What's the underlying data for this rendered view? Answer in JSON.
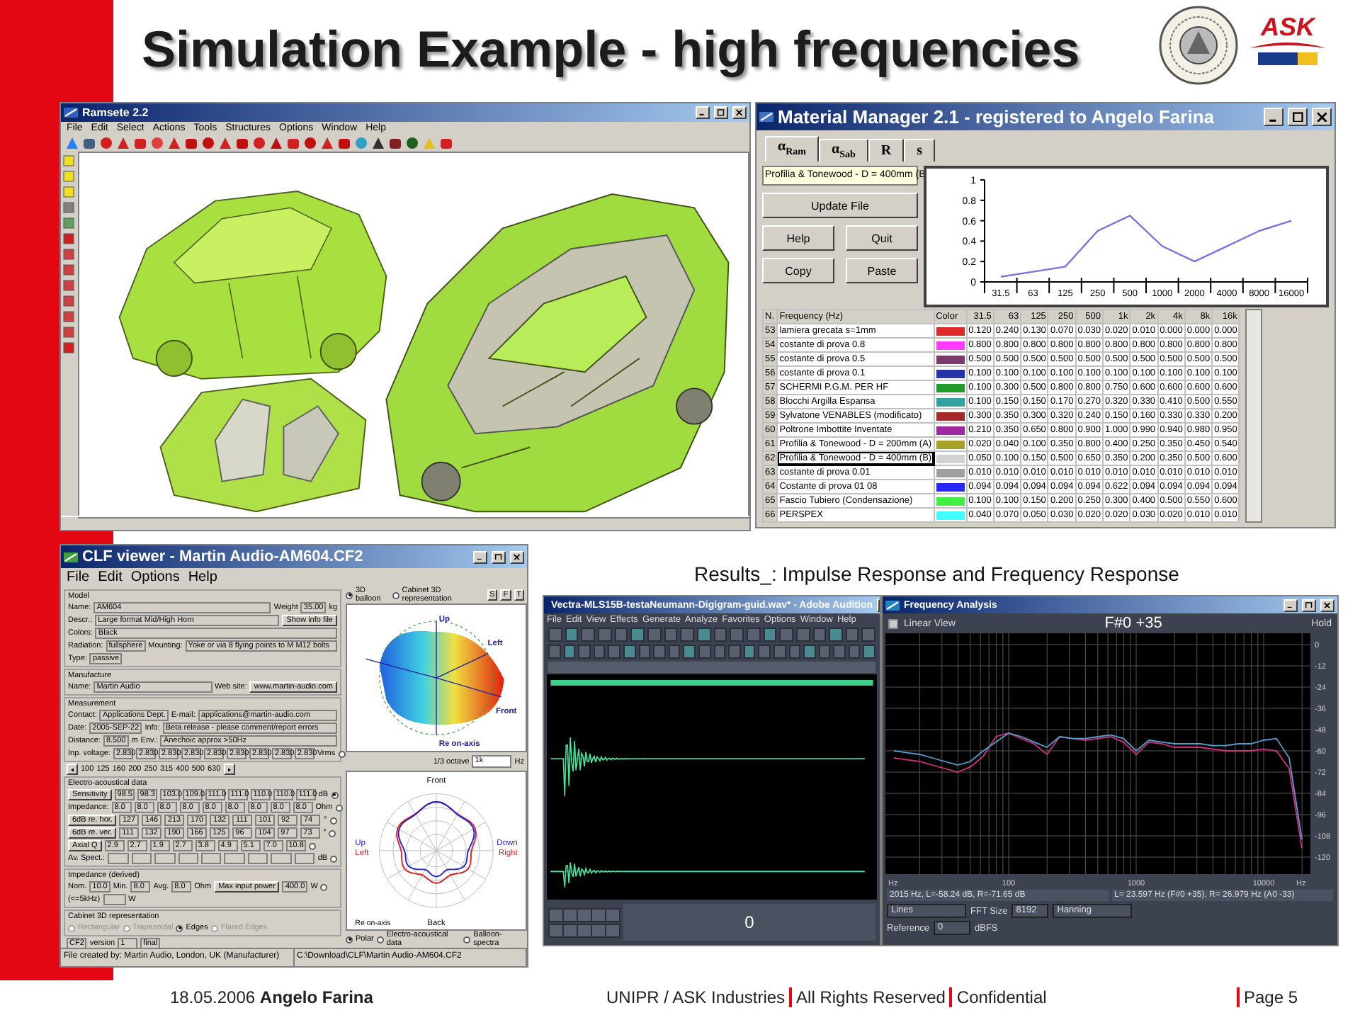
{
  "slide": {
    "title": "Simulation Example - high frequencies",
    "logo_text": "ASK",
    "results_caption": "Results_: Impulse Response and Frequency Response"
  },
  "ramsete": {
    "title": "Ramsete 2.2",
    "menu": [
      "File",
      "Edit",
      "Select",
      "Actions",
      "Tools",
      "Structures",
      "Options",
      "Window",
      "Help"
    ]
  },
  "material_manager": {
    "title": "Material Manager 2.1 - registered to Angelo Farina",
    "tabs": [
      {
        "label": "α$_{Ram}$",
        "selected": true
      },
      {
        "label": "α$_{Sab}$",
        "selected": false
      },
      {
        "label": "R",
        "selected": false
      },
      {
        "label": "s",
        "selected": false
      }
    ],
    "material_field": "Profilia & Tonewood - D = 400mm (B",
    "buttons": [
      "Update File",
      "Help",
      "Quit",
      "Copy",
      "Paste"
    ],
    "chart_data": {
      "type": "line",
      "categories": [
        "31.5",
        "63",
        "125",
        "250",
        "500",
        "1000",
        "2000",
        "4000",
        "8000",
        "16000"
      ],
      "ylim": [
        0,
        1
      ],
      "yticks": [
        0,
        0.2,
        0.4,
        0.6,
        0.8,
        1
      ],
      "series": [
        {
          "color": "#7b72e6",
          "values": [
            0.05,
            0.1,
            0.15,
            0.5,
            0.65,
            0.35,
            0.2,
            0.35,
            0.5,
            0.6
          ]
        }
      ]
    },
    "table": {
      "columns": [
        "N.",
        "Frequency (Hz)",
        "Color",
        "31.5",
        "63",
        "125",
        "250",
        "500",
        "1k",
        "2k",
        "4k",
        "8k",
        "16k"
      ],
      "rows": [
        {
          "n": "53",
          "name": "lamiera grecata s=1mm",
          "color": "#e02828",
          "selected": false,
          "values": [
            "0.120",
            "0.240",
            "0.130",
            "0.070",
            "0.030",
            "0.020",
            "0.010",
            "0.000",
            "0.000",
            "0.000"
          ]
        },
        {
          "n": "54",
          "name": "costante di prova 0.8",
          "color": "#ff3cff",
          "selected": false,
          "values": [
            "0.800",
            "0.800",
            "0.800",
            "0.800",
            "0.800",
            "0.800",
            "0.800",
            "0.800",
            "0.800",
            "0.800"
          ]
        },
        {
          "n": "55",
          "name": "costante di prova 0.5",
          "color": "#7a3a6a",
          "selected": false,
          "values": [
            "0.500",
            "0.500",
            "0.500",
            "0.500",
            "0.500",
            "0.500",
            "0.500",
            "0.500",
            "0.500",
            "0.500"
          ]
        },
        {
          "n": "56",
          "name": "costante di prova 0.1",
          "color": "#2832a8",
          "selected": false,
          "values": [
            "0.100",
            "0.100",
            "0.100",
            "0.100",
            "0.100",
            "0.100",
            "0.100",
            "0.100",
            "0.100",
            "0.100"
          ]
        },
        {
          "n": "57",
          "name": "SCHERMI P.G.M. PER HF",
          "color": "#209a28",
          "selected": false,
          "values": [
            "0.100",
            "0.300",
            "0.500",
            "0.800",
            "0.800",
            "0.750",
            "0.600",
            "0.600",
            "0.600",
            "0.600"
          ]
        },
        {
          "n": "58",
          "name": "Blocchi Argilla Espansa",
          "color": "#30a0a0",
          "selected": false,
          "values": [
            "0.100",
            "0.150",
            "0.150",
            "0.170",
            "0.270",
            "0.320",
            "0.330",
            "0.410",
            "0.500",
            "0.550"
          ]
        },
        {
          "n": "59",
          "name": "Sylvatone VENABLES (modificato)",
          "color": "#a82828",
          "selected": false,
          "values": [
            "0.300",
            "0.350",
            "0.300",
            "0.320",
            "0.240",
            "0.150",
            "0.160",
            "0.330",
            "0.330",
            "0.200"
          ]
        },
        {
          "n": "60",
          "name": "Poltrone Imbottite Inventate",
          "color": "#a028a0",
          "selected": false,
          "values": [
            "0.210",
            "0.350",
            "0.650",
            "0.800",
            "0.900",
            "1.000",
            "0.990",
            "0.940",
            "0.980",
            "0.950"
          ]
        },
        {
          "n": "61",
          "name": "Profilia & Tonewood - D = 200mm (A)",
          "color": "#a8a028",
          "selected": false,
          "values": [
            "0.020",
            "0.040",
            "0.100",
            "0.350",
            "0.800",
            "0.400",
            "0.250",
            "0.350",
            "0.450",
            "0.540"
          ]
        },
        {
          "n": "62",
          "name": "Profilia & Tonewood - D = 400mm (B)",
          "color": "#d2d2d2",
          "selected": true,
          "values": [
            "0.050",
            "0.100",
            "0.150",
            "0.500",
            "0.650",
            "0.350",
            "0.200",
            "0.350",
            "0.500",
            "0.600"
          ]
        },
        {
          "n": "63",
          "name": "costante di prova 0.01",
          "color": "#a0a0a0",
          "selected": false,
          "values": [
            "0.010",
            "0.010",
            "0.010",
            "0.010",
            "0.010",
            "0.010",
            "0.010",
            "0.010",
            "0.010",
            "0.010"
          ]
        },
        {
          "n": "64",
          "name": "Costante di prova 01 08",
          "color": "#2828ff",
          "selected": false,
          "values": [
            "0.094",
            "0.094",
            "0.094",
            "0.094",
            "0.094",
            "0.622",
            "0.094",
            "0.094",
            "0.094",
            "0.094"
          ]
        },
        {
          "n": "65",
          "name": "Fascio Tubiero (Condensazione)",
          "color": "#40f040",
          "selected": false,
          "values": [
            "0.100",
            "0.100",
            "0.150",
            "0.200",
            "0.250",
            "0.300",
            "0.400",
            "0.500",
            "0.550",
            "0.600"
          ]
        },
        {
          "n": "66",
          "name": "PERSPEX",
          "color": "#40ffff",
          "selected": false,
          "values": [
            "0.040",
            "0.070",
            "0.050",
            "0.030",
            "0.020",
            "0.020",
            "0.030",
            "0.020",
            "0.010",
            "0.010"
          ]
        }
      ]
    }
  },
  "clf_viewer": {
    "title": "CLF viewer - Martin Audio-AM604.CF2",
    "menu": [
      "File",
      "Edit",
      "Options",
      "Help"
    ],
    "groups": [
      {
        "title": "Model",
        "rows": [
          [
            {
              "kind": "label",
              "text": "Name:"
            },
            {
              "kind": "field",
              "text": "AM604"
            },
            {
              "kind": "label",
              "text": "Weight"
            },
            {
              "kind": "cell",
              "text": "35.00"
            },
            {
              "kind": "label",
              "text": "kg"
            }
          ],
          [
            {
              "kind": "label",
              "text": "Descr.:"
            },
            {
              "kind": "field",
              "text": "Large format Mid/High Horn"
            },
            {
              "kind": "button",
              "text": "Show info file"
            }
          ],
          [
            {
              "kind": "label",
              "text": "Colors:"
            },
            {
              "kind": "field",
              "text": "Black"
            }
          ],
          [
            {
              "kind": "label",
              "text": "Radiation:"
            },
            {
              "kind": "cell",
              "text": "fullsphere"
            },
            {
              "kind": "label",
              "text": "Mounting:"
            },
            {
              "kind": "field",
              "text": "Yoke or via 8 flying points to M M12 bolts"
            }
          ],
          [
            {
              "kind": "label",
              "text": "Type:"
            },
            {
              "kind": "cell",
              "text": "passive"
            }
          ]
        ]
      },
      {
        "title": "Manufacture",
        "rows": [
          [
            {
              "kind": "label",
              "text": "Name:"
            },
            {
              "kind": "field",
              "text": "Martin Audio"
            },
            {
              "kind": "label",
              "text": "Web site:"
            },
            {
              "kind": "button",
              "text": "www.martin-audio.com"
            }
          ]
        ]
      },
      {
        "title": "Measurement",
        "fields": [
          {
            "label": "Contact:",
            "value": "Applications Dept.",
            "label_2": "E-mail:",
            "value_2": "applications@martin-audio.com"
          },
          {
            "label": "Date:",
            "value": "2005-SEP-22",
            "label_2": "Info:",
            "value_2": "Beta release - please comment/report errors"
          },
          {
            "label": "Distance:",
            "value": "8.500",
            "unit": "m",
            "label_2": "Env.:",
            "value_2": "Anechoic approx >50Hz"
          }
        ],
        "voltage": {
          "label": "Inp. voltage:",
          "values": [
            "2.830",
            "2.830",
            "2.830",
            "2.830",
            "2.830",
            "2.830",
            "2.830",
            "2.830",
            "2.830"
          ],
          "unit": "Vrms",
          "selected": false
        }
      },
      {
        "rows": [
          [
            {
              "kind": "arrow_left"
            },
            {
              "kind": "label",
              "text": "100"
            },
            {
              "kind": "label",
              "text": "125"
            },
            {
              "kind": "label",
              "text": "160"
            },
            {
              "kind": "label",
              "text": "200"
            },
            {
              "kind": "label",
              "text": "250"
            },
            {
              "kind": "label",
              "text": "315"
            },
            {
              "kind": "label",
              "text": "400"
            },
            {
              "kind": "label",
              "text": "500"
            },
            {
              "kind": "label",
              "text": "630"
            },
            {
              "kind": "arrow_right"
            }
          ]
        ]
      },
      {
        "title": "Electro-acoustical data",
        "rows": [
          [
            {
              "kind": "button",
              "text": "Sensitivity"
            },
            {
              "kind": "cell",
              "text": "98.5"
            },
            {
              "kind": "cell",
              "text": "98.3"
            },
            {
              "kind": "cell",
              "text": "103.0"
            },
            {
              "kind": "cell",
              "text": "109.0"
            },
            {
              "kind": "cell",
              "text": "111.0"
            },
            {
              "kind": "cell",
              "text": "111.0"
            },
            {
              "kind": "cell",
              "text": "110.0"
            },
            {
              "kind": "cell",
              "text": "110.0"
            },
            {
              "kind": "cell",
              "text": "111.0"
            },
            {
              "kind": "label",
              "text": "dB"
            },
            {
              "kind": "radio",
              "selected": true
            }
          ],
          [
            {
              "kind": "label",
              "text": "Impedance:"
            },
            {
              "kind": "cell",
              "text": "8.0"
            },
            {
              "kind": "cell",
              "text": "8.0"
            },
            {
              "kind": "cell",
              "text": "8.0"
            },
            {
              "kind": "cell",
              "text": "8.0"
            },
            {
              "kind": "cell",
              "text": "8.0"
            },
            {
              "kind": "cell",
              "text": "8.0"
            },
            {
              "kind": "cell",
              "text": "8.0"
            },
            {
              "kind": "cell",
              "text": "8.0"
            },
            {
              "kind": "cell",
              "text": "8.0"
            },
            {
              "kind": "label",
              "text": "Ohm"
            },
            {
              "kind": "radio",
              "selected": false
            }
          ],
          [
            {
              "kind": "button",
              "text": "6dB re. hor."
            },
            {
              "kind": "cell",
              "text": "127"
            },
            {
              "kind": "cell",
              "text": "146"
            },
            {
              "kind": "cell",
              "text": "213"
            },
            {
              "kind": "cell",
              "text": "170"
            },
            {
              "kind": "cell",
              "text": "132"
            },
            {
              "kind": "cell",
              "text": "111"
            },
            {
              "kind": "cell",
              "text": "101"
            },
            {
              "kind": "cell",
              "text": "92"
            },
            {
              "kind": "cell",
              "text": "74"
            },
            {
              "kind": "label",
              "text": "°"
            },
            {
              "kind": "radio",
              "selected": false
            }
          ],
          [
            {
              "kind": "button",
              "text": "6dB re. ver."
            },
            {
              "kind": "cell",
              "text": "111"
            },
            {
              "kind": "cell",
              "text": "132"
            },
            {
              "kind": "cell",
              "text": "190"
            },
            {
              "kind": "cell",
              "text": "166"
            },
            {
              "kind": "cell",
              "text": "125"
            },
            {
              "kind": "cell",
              "text": "96"
            },
            {
              "kind": "cell",
              "text": "104"
            },
            {
              "kind": "cell",
              "text": "97"
            },
            {
              "kind": "cell",
              "text": "73"
            },
            {
              "kind": "label",
              "text": "°"
            },
            {
              "kind": "radio",
              "selected": false
            }
          ],
          [
            {
              "kind": "button",
              "text": "Axial Q"
            },
            {
              "kind": "cell",
              "text": "2.9"
            },
            {
              "kind": "cell",
              "text": "2.7"
            },
            {
              "kind": "cell",
              "text": "1.9"
            },
            {
              "kind": "cell",
              "text": "2.7"
            },
            {
              "kind": "cell",
              "text": "3.8"
            },
            {
              "kind": "cell",
              "text": "4.9"
            },
            {
              "kind": "cell",
              "text": "5.1"
            },
            {
              "kind": "cell",
              "text": "7.0"
            },
            {
              "kind": "cell",
              "text": "10.8"
            },
            {
              "kind": "radio",
              "selected": false
            }
          ],
          [
            {
              "kind": "label",
              "text": "Av. Spect.:"
            },
            {
              "kind": "empty"
            },
            {
              "kind": "empty"
            },
            {
              "kind": "empty"
            },
            {
              "kind": "empty"
            },
            {
              "kind": "empty"
            },
            {
              "kind": "empty"
            },
            {
              "kind": "empty"
            },
            {
              "kind": "empty"
            },
            {
              "kind": "empty"
            },
            {
              "kind": "label",
              "text": "dB"
            },
            {
              "kind": "radio",
              "selected": false
            }
          ]
        ]
      },
      {
        "title": "Impedance (derived)",
        "rows": [
          [
            {
              "kind": "label",
              "text": "Nom."
            },
            {
              "kind": "cell",
              "text": "10.0"
            },
            {
              "kind": "label",
              "text": "Min."
            },
            {
              "kind": "cell",
              "text": "8.0"
            },
            {
              "kind": "label",
              "text": "Avg."
            },
            {
              "kind": "cell",
              "text": "8.0"
            },
            {
              "kind": "label",
              "text": "Ohm"
            },
            {
              "kind": "button",
              "text": "Max input power"
            },
            {
              "kind": "cell",
              "text": "400.0"
            },
            {
              "kind": "label",
              "text": "W"
            },
            {
              "kind": "radio",
              "selected": false
            }
          ],
          [
            {
              "kind": "label",
              "text": "(<=5kHz)"
            },
            {
              "kind": "empty"
            },
            {
              "kind": "label",
              "text": "W"
            }
          ]
        ]
      },
      {
        "title": "Cabinet 3D representation",
        "rows": [
          [
            {
              "kind": "radio",
              "text": "Rectangular",
              "selected": false,
              "disabled": true
            },
            {
              "kind": "radio",
              "text": "Trapezoidal",
              "selected": false,
              "disabled": true
            },
            {
              "kind": "radio",
              "text": "Edges",
              "selected": true,
              "disabled": false
            },
            {
              "kind": "radio",
              "text": "Flared Edges",
              "selected": false,
              "disabled": true
            }
          ]
        ]
      },
      {
        "rows": [
          [
            {
              "kind": "cell",
              "text": "CF2"
            },
            {
              "kind": "label",
              "text": "version"
            },
            {
              "kind": "cell",
              "text": "1"
            },
            {
              "kind": "cell",
              "text": "final"
            }
          ]
        ]
      }
    ],
    "view_options": [
      {
        "text": "3D balloon",
        "selected": true
      },
      {
        "text": "Cabinet 3D representation",
        "selected": false
      }
    ],
    "view_buttons": [
      "S",
      "F",
      "T"
    ],
    "balloon_labels": [
      "Up",
      "Left",
      "Front",
      "Re on-axis"
    ],
    "octave": {
      "label": "1/3 octave",
      "value": "1k",
      "unit": "Hz"
    },
    "polar_labels": {
      "top": "Front",
      "bottom": "Back",
      "left": [
        "Up",
        "Left"
      ],
      "right": [
        "Down",
        "Right"
      ],
      "corner": "Re on-axis"
    },
    "plot_options": [
      {
        "text": "Polar",
        "selected": true
      },
      {
        "text": "Electro-acoustical data",
        "selected": false
      },
      {
        "text": "Balloon-spectra",
        "selected": false
      }
    ],
    "status": [
      "File created by: Martin Audio, London, UK (Manufacturer)",
      "C:\\Download\\CLF\\Martin Audio-AM604.CF2"
    ]
  },
  "audition": {
    "title": "Vectra-MLS15B-testaNeumann-Digigram-guid.wav* - Adobe Audition",
    "menu": [
      "File",
      "Edit",
      "View",
      "Effects",
      "Generate",
      "Analyze",
      "Favorites",
      "Options",
      "Window",
      "Help"
    ],
    "counter": "0"
  },
  "frequency_analysis": {
    "title": "Frequency Analysis",
    "linear_view": {
      "label": "Linear View",
      "checked": false
    },
    "note": "F#0 +35",
    "hold": "Hold",
    "chart_data": {
      "type": "line",
      "categories": [
        null,
        null,
        null,
        null,
        null,
        null,
        null,
        null,
        null,
        "100",
        null,
        null,
        null,
        null,
        null,
        null,
        null,
        null,
        null,
        "1000",
        null,
        null,
        null,
        null,
        null,
        null,
        null,
        null,
        null,
        "10000",
        null,
        null,
        null
      ],
      "ylim": [
        -120,
        0
      ],
      "yticks": [
        0,
        -12,
        -24,
        -36,
        -48,
        -60,
        -72,
        -84,
        -96,
        -108,
        -120
      ],
      "grid": true,
      "series": [
        {
          "color": "#d03080",
          "values": [
            -64,
            -65,
            -66,
            -68,
            -70,
            -72,
            -69,
            -63,
            -52,
            -50,
            -53,
            -56,
            -62,
            -52,
            -53,
            -54,
            -53,
            -52,
            -55,
            -62,
            -55,
            -56,
            -58,
            -58,
            -58,
            -59,
            -60,
            -60,
            -60,
            -59,
            -60,
            -70,
            -115
          ]
        },
        {
          "color": "#50a0d0",
          "values": [
            -60,
            -61,
            -62,
            -64,
            -66,
            -68,
            -66,
            -60,
            -55,
            -50,
            -52,
            -55,
            -58,
            -52,
            -53,
            -53,
            -52,
            -51,
            -53,
            -60,
            -54,
            -55,
            -56,
            -56,
            -56,
            -57,
            -57,
            -56,
            -56,
            -54,
            -53,
            -64,
            -110
          ]
        }
      ]
    },
    "x_unit_labels": [
      "Hz",
      "Hz"
    ],
    "status": [
      "2015 Hz, L=-58.24 dB, R=-71.65 dB",
      "L= 23.597 Hz (F#0 +35), R= 26.979 Hz (A0 -33)"
    ],
    "display": "Lines",
    "fft_label": "FFT Size",
    "fft_size": "8192",
    "window": "Hanning",
    "reference_label": "Reference",
    "reference": "0",
    "reference_unit": "dBFS"
  },
  "footer": {
    "date_author": "18.05.2006 **Angelo Farina**",
    "notices": [
      "UNIPR / ASK Industries",
      "All Rights Reserved",
      "Confidential"
    ],
    "page": "Page 5"
  }
}
